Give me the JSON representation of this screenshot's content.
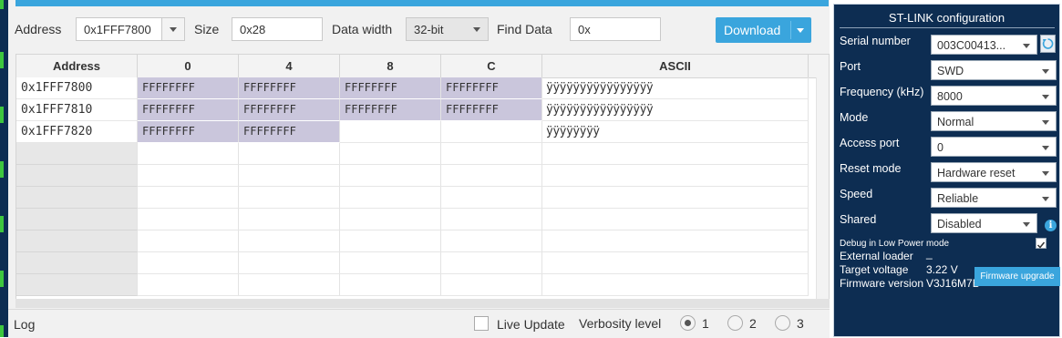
{
  "toolbar": {
    "address_label": "Address",
    "address_value": "0x1FFF7800",
    "size_label": "Size",
    "size_value": "0x28",
    "data_width_label": "Data width",
    "data_width_value": "32-bit",
    "find_label": "Find Data",
    "find_value": "0x",
    "download_label": "Download"
  },
  "table": {
    "headers": [
      "Address",
      "0",
      "4",
      "8",
      "C",
      "ASCII"
    ],
    "rows": [
      {
        "address": "0x1FFF7800",
        "c0": "FFFFFFFF",
        "c4": "FFFFFFFF",
        "c8": "FFFFFFFF",
        "cC": "FFFFFFFF",
        "ascii": "ÿÿÿÿÿÿÿÿÿÿÿÿÿÿÿÿ"
      },
      {
        "address": "0x1FFF7810",
        "c0": "FFFFFFFF",
        "c4": "FFFFFFFF",
        "c8": "FFFFFFFF",
        "cC": "FFFFFFFF",
        "ascii": "ÿÿÿÿÿÿÿÿÿÿÿÿÿÿÿÿ"
      },
      {
        "address": "0x1FFF7820",
        "c0": "FFFFFFFF",
        "c4": "FFFFFFFF",
        "c8": "",
        "cC": "",
        "ascii": "ÿÿÿÿÿÿÿÿ"
      }
    ]
  },
  "logbar": {
    "log_label": "Log",
    "live_update_label": "Live Update",
    "verbosity_label": "Verbosity level",
    "levels": [
      "1",
      "2",
      "3"
    ],
    "selected_level": "1"
  },
  "stlink": {
    "title": "ST-LINK configuration",
    "serial_label": "Serial number",
    "serial_value": "003C00413...",
    "port_label": "Port",
    "port_value": "SWD",
    "frequency_label": "Frequency (kHz)",
    "frequency_value": "8000",
    "mode_label": "Mode",
    "mode_value": "Normal",
    "access_port_label": "Access port",
    "access_port_value": "0",
    "reset_mode_label": "Reset mode",
    "reset_mode_value": "Hardware reset",
    "speed_label": "Speed",
    "speed_value": "Reliable",
    "shared_label": "Shared",
    "shared_value": "Disabled",
    "debug_low_power_label": "Debug in Low Power mode",
    "debug_low_power_checked": true,
    "external_loader_label": "External loader",
    "external_loader_value": "_",
    "target_voltage_label": "Target voltage",
    "target_voltage_value": "3.22 V",
    "firmware_version_label": "Firmware version",
    "firmware_version_value": "V3J16M7B",
    "firmware_upgrade_label": "Firmware upgrade"
  }
}
